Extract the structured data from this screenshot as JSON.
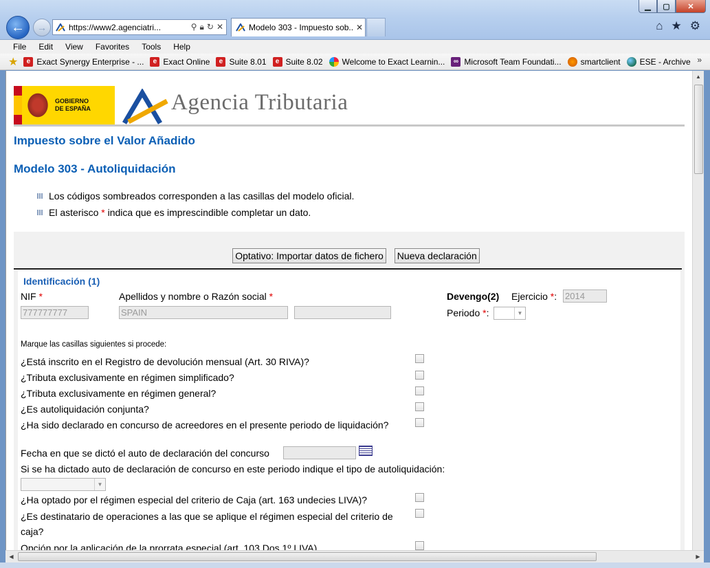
{
  "browser": {
    "address_url": "https://www2.agenciatri...",
    "tab_title": "Modelo 303 - Impuesto sob...",
    "window_buttons": [
      "minimize-icon",
      "maximize-icon",
      "close-icon"
    ],
    "tool_icons": [
      "home-icon",
      "star-icon",
      "gear-icon"
    ],
    "menu": [
      "File",
      "Edit",
      "View",
      "Favorites",
      "Tools",
      "Help"
    ],
    "favorites": [
      {
        "label": "Exact Synergy Enterprise - ...",
        "icon": "exact-icon"
      },
      {
        "label": "Exact Online",
        "icon": "exact-icon"
      },
      {
        "label": "Suite 8.01",
        "icon": "exact-icon"
      },
      {
        "label": "Suite 8.02",
        "icon": "exact-icon"
      },
      {
        "label": "Welcome to Exact Learnin...",
        "icon": "learning-icon"
      },
      {
        "label": "Microsoft Team Foundati...",
        "icon": "visual-studio-icon"
      },
      {
        "label": "smartclient",
        "icon": "smartclient-icon"
      },
      {
        "label": "ESE - Archive",
        "icon": "globe-icon"
      }
    ],
    "favorites_more": "»"
  },
  "page": {
    "logo_gobierno_text": [
      "GOBIERNO",
      "DE ESPAÑA"
    ],
    "agency_name": "Agencia Tributaria",
    "heading1": "Impuesto sobre el Valor Añadido",
    "heading2": "Modelo 303 - Autoliquidación",
    "bullet1": "Los códigos sombreados corresponden a las casillas del modelo oficial.",
    "bullet2_pre": "El asterisco",
    "bullet2_star": "*",
    "bullet2_post": "indica que es imprescindible completar un dato.",
    "btn_import": "Optativo: Importar datos de fichero",
    "btn_new": "Nueva declaración",
    "section_title": "Identificación (1)",
    "nif_label": "NIF",
    "nif_value": "777777777",
    "name_label": "Apellidos y nombre o Razón social",
    "name_value": "SPAIN",
    "name_value2": "",
    "devengo_label": "Devengo(2)",
    "ejercicio_label": "Ejercicio",
    "ejercicio_value": "2014",
    "periodo_label": "Periodo",
    "req_star": "*",
    "colon": ":",
    "marque_label": "Marque las casillas siguientes si procede:",
    "q1": "¿Está inscrito en el Registro de devolución mensual (Art. 30 RIVA)?",
    "q2": "¿Tributa exclusivamente en régimen simplificado?",
    "q3": "¿Tributa exclusivamente en régimen general?",
    "q4": "¿Es autoliquidación conjunta?",
    "q5": "¿Ha sido declarado en concurso de acreedores en el presente periodo de liquidación?",
    "fecha_label": "Fecha en que se dictó el auto de declaración del concurso",
    "tipo_label": "Si se ha dictado auto de declaración de concurso en este periodo indique el tipo de autoliquidación:",
    "q6": "¿Ha optado por el régimen especial del criterio de Caja (art. 163 undecies LIVA)?",
    "q7a": "¿Es destinatario de operaciones a las que se aplique el régimen especial del criterio de",
    "q7b": "caja?",
    "q8": "Opción por la aplicación de la prorrata especial (art. 103.Dos.1º LIVA)"
  }
}
